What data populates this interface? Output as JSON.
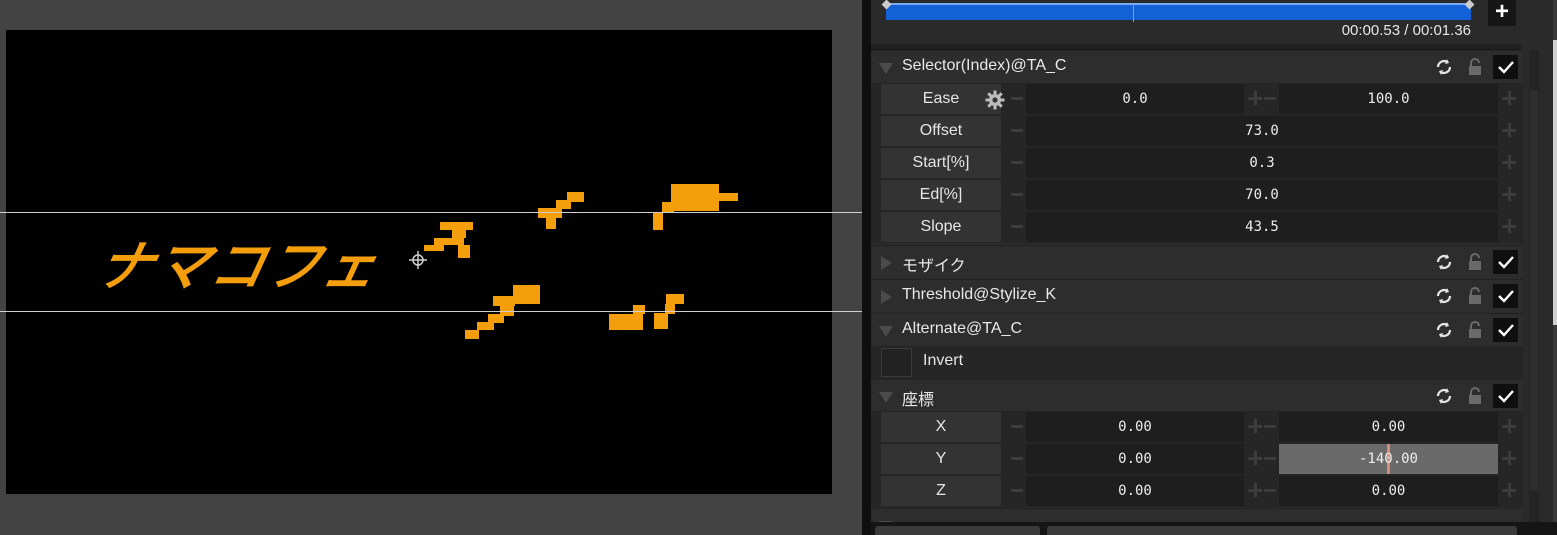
{
  "preview": {
    "text": "ナマコフェ"
  },
  "timeline": {
    "time_readout": "00:00.53 / 00:01.36",
    "add_label": "+"
  },
  "sections": {
    "selector": {
      "title": "Selector(Index)@TA_C",
      "rows": {
        "ease": {
          "label": "Ease",
          "value_a": "0.0",
          "value_b": "100.0"
        },
        "offset": {
          "label": "Offset",
          "value": "73.0"
        },
        "start": {
          "label": "Start[%]",
          "value": "0.3"
        },
        "ed": {
          "label": "Ed[%]",
          "value": "70.0"
        },
        "slope": {
          "label": "Slope",
          "value": "43.5"
        }
      }
    },
    "mosaic": {
      "title": "モザイク"
    },
    "threshold": {
      "title": "Threshold@Stylize_K"
    },
    "alternate": {
      "title": "Alternate@TA_C",
      "invert_label": "Invert"
    },
    "coords": {
      "title": "座標",
      "rows": {
        "x": {
          "label": "X",
          "value_a": "0.00",
          "value_b": "0.00"
        },
        "y": {
          "label": "Y",
          "value_a": "0.00",
          "value_b": "-140.00"
        },
        "z": {
          "label": "Z",
          "value_a": "0.00",
          "value_b": "0.00"
        }
      }
    }
  },
  "colors": {
    "accent_orange": "#f59e0b",
    "timeline_blue": "#1460d6",
    "panel_bg": "#2a2a2a"
  },
  "icons": {
    "reset": "refresh-icon",
    "lock": "lock-icon",
    "enable": "check-icon",
    "ease_settings": "gear-icon",
    "add": "plus-icon"
  }
}
